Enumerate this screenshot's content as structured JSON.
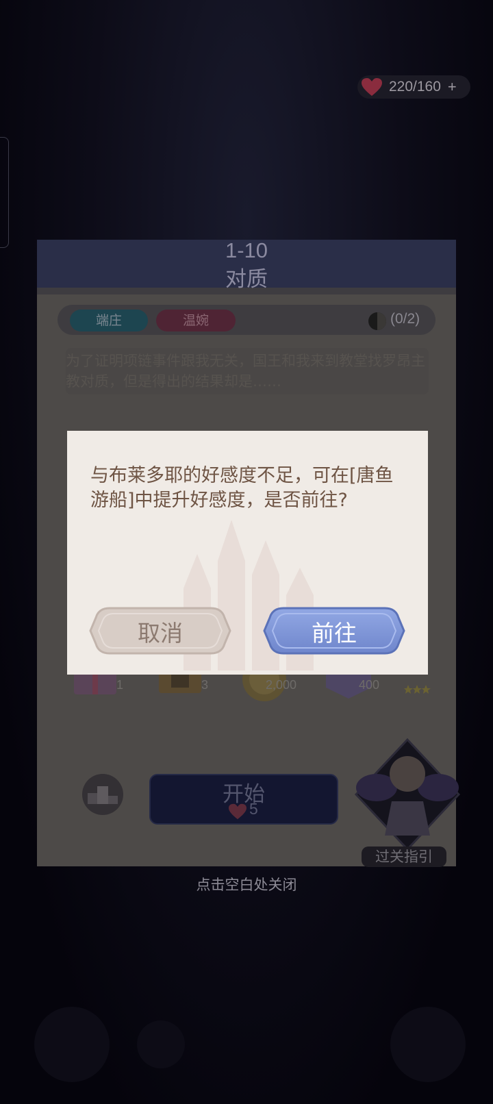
{
  "status": {
    "hearts_count": "220/160",
    "add_label": "+"
  },
  "level": {
    "number": "1-10",
    "name": "对质",
    "tags": [
      "端庄",
      "温婉"
    ],
    "progress": "(0/2)",
    "description": "为了证明项链事件跟我无关，国王和我来到教堂找罗昂主教对质，但是得出的结果却是……",
    "rewards": [
      {
        "icon": "gift-box-icon",
        "count": "1"
      },
      {
        "icon": "book-icon",
        "count": "3"
      },
      {
        "icon": "gold-coin-icon",
        "count": "2,000"
      },
      {
        "icon": "experience-icon",
        "count": "400"
      }
    ],
    "start_label": "开始",
    "start_cost": "5",
    "guide_label": "过关指引"
  },
  "dialog": {
    "message": "与布莱多耶的好感度不足，可在[唐鱼游船]中提升好感度，是否前往?",
    "cancel_label": "取消",
    "go_label": "前往"
  },
  "close_hint": "点击空白处关闭",
  "colors": {
    "dialog_bg": "#f0ebe6",
    "go_button": "#7f96d8",
    "cancel_button": "#d8cdc6",
    "message_text": "#6e5444"
  }
}
